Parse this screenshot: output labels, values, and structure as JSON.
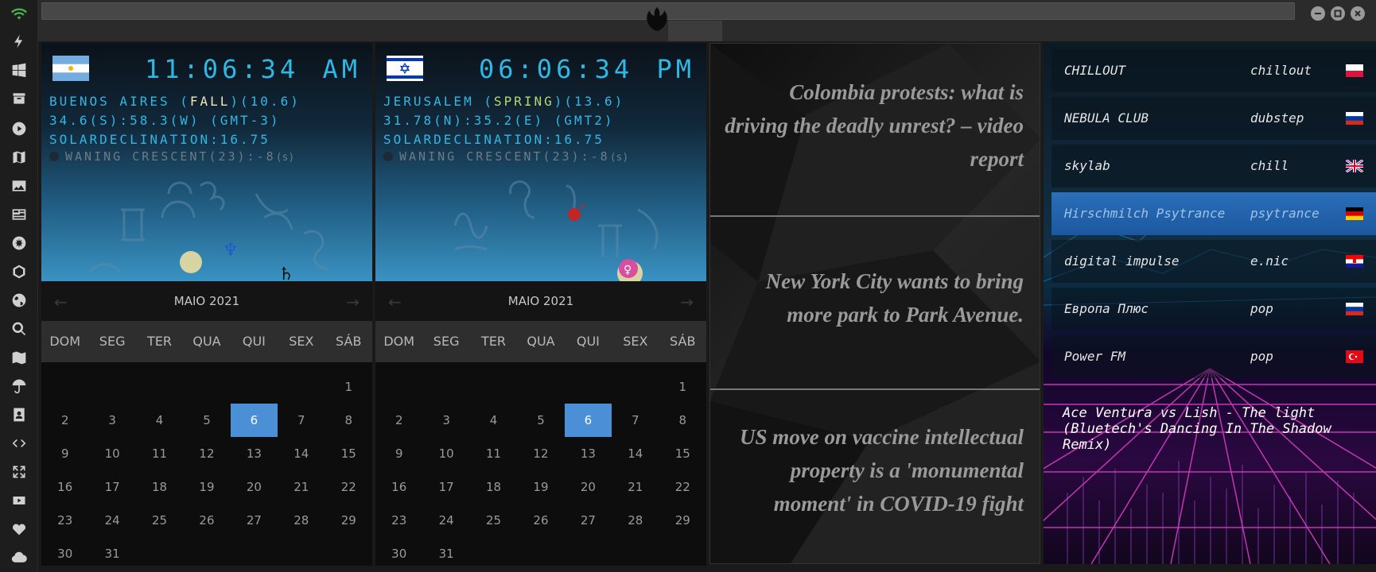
{
  "sidebar": {
    "icons": [
      "wifi-icon",
      "bolt-icon",
      "windows-icon",
      "archive-icon",
      "play-icon",
      "map-book-icon",
      "image-icon",
      "news-icon",
      "rebel-icon",
      "hexagon-icon",
      "globe-icon",
      "search-icon",
      "map-icon",
      "umbrella-icon",
      "contact-icon",
      "code-icon",
      "expand-icon",
      "youtube-icon",
      "heart-icon",
      "cloud-icon"
    ]
  },
  "clocks": [
    {
      "flag": "argentina",
      "time": "11:06:34",
      "ampm": "AM",
      "city": "BUENOS AIRES",
      "season": "FALL",
      "season_extra": "(10.6)",
      "coords": "34.6(S):58.3(W) (GMT-3)",
      "declination": "SOLARDECLINATION:16.75",
      "moon": "WANING CRESCENT(23):-8",
      "moon_unit": "(s)",
      "calendar": {
        "month": "MAIO 2021",
        "days": [
          "DOM",
          "SEG",
          "TER",
          "QUA",
          "QUI",
          "SEX",
          "SÁB"
        ],
        "weeks": [
          [
            "",
            "",
            "",
            "",
            "",
            "",
            "1"
          ],
          [
            "2",
            "3",
            "4",
            "5",
            "6",
            "7",
            "8"
          ],
          [
            "9",
            "10",
            "11",
            "12",
            "13",
            "14",
            "15"
          ],
          [
            "16",
            "17",
            "18",
            "19",
            "20",
            "21",
            "22"
          ],
          [
            "23",
            "24",
            "25",
            "26",
            "27",
            "28",
            "29"
          ],
          [
            "30",
            "31",
            "",
            "",
            "",
            "",
            ""
          ]
        ],
        "today": "6"
      }
    },
    {
      "flag": "israel",
      "time": "06:06:34",
      "ampm": "PM",
      "city": "JERUSALEM",
      "season": "SPRING",
      "season_extra": "(13.6)",
      "coords": "31.78(N):35.2(E) (GMT2)",
      "declination": "SOLARDECLINATION:16.75",
      "moon": "WANING CRESCENT(23):-8",
      "moon_unit": "(s)",
      "calendar": {
        "month": "MAIO 2021",
        "days": [
          "DOM",
          "SEG",
          "TER",
          "QUA",
          "QUI",
          "SEX",
          "SÁB"
        ],
        "weeks": [
          [
            "",
            "",
            "",
            "",
            "",
            "",
            "1"
          ],
          [
            "2",
            "3",
            "4",
            "5",
            "6",
            "7",
            "8"
          ],
          [
            "9",
            "10",
            "11",
            "12",
            "13",
            "14",
            "15"
          ],
          [
            "16",
            "17",
            "18",
            "19",
            "20",
            "21",
            "22"
          ],
          [
            "23",
            "24",
            "25",
            "26",
            "27",
            "28",
            "29"
          ],
          [
            "30",
            "31",
            "",
            "",
            "",
            "",
            ""
          ]
        ],
        "today": "6"
      }
    }
  ],
  "news": [
    {
      "headline": "Colombia protests: what is driving the deadly unrest? – video report"
    },
    {
      "headline": "New York City wants to bring more park to Park Avenue."
    },
    {
      "headline": "US move on vaccine intellectual property is a 'monumental moment' in COVID-19 fight"
    }
  ],
  "radio": {
    "stations": [
      {
        "name": "CHILLOUT",
        "genre": "chillout",
        "flag": "poland",
        "active": false
      },
      {
        "name": "NEBULA CLUB",
        "genre": "dubstep",
        "flag": "russia",
        "active": false
      },
      {
        "name": "skylab",
        "genre": "chill",
        "flag": "uk",
        "active": false
      },
      {
        "name": "Hirschmilch Psytrance",
        "genre": "psytrance",
        "flag": "germany",
        "active": true
      },
      {
        "name": "digital impulse",
        "genre": "e.nic",
        "flag": "croatia",
        "active": false
      },
      {
        "name": "Европа Плюс",
        "genre": "pop",
        "flag": "russia",
        "active": false
      },
      {
        "name": "Power FM",
        "genre": "pop",
        "flag": "turkey",
        "active": false
      }
    ],
    "now_playing": "Ace Ventura vs Lish - The light (Bluetech's Dancing In The Shadow Remix)"
  },
  "colors": {
    "clock_text": "#2fb8e6",
    "today_highlight": "#4b8fd6",
    "active_station": "#2a6fb8"
  }
}
